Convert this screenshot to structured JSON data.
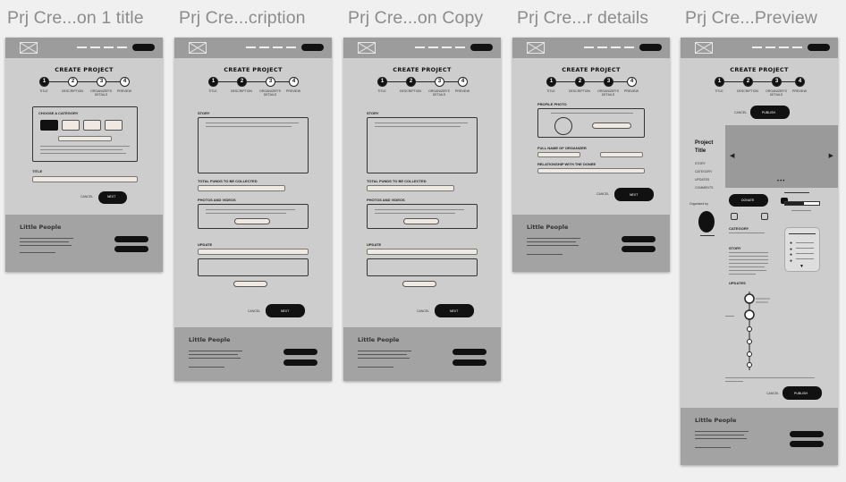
{
  "artboards": [
    {
      "title": "Prj Cre...on 1 title"
    },
    {
      "title": "Prj Cre...cription"
    },
    {
      "title": "Prj Cre...on Copy"
    },
    {
      "title": "Prj Cre...r details"
    },
    {
      "title": "Prj Cre...Preview"
    }
  ],
  "page": {
    "heading": "CREATE PROJECT",
    "steps": [
      "TITLE",
      "DESCRIPTION",
      "ORGANIZER'S DETAILS",
      "PREVIEW"
    ],
    "choose_category": "CHOOSE A CATEGORY",
    "title_label": "TITLE",
    "story_label": "STORY",
    "total_funds_label": "TOTAL FUNDS TO BE COLLECTED",
    "photos_label": "PHOTOS AND VIDEOS",
    "update_label": "UPDATE",
    "profile_photo_label": "PROFILE PHOTO",
    "full_name_label": "FULL NAME OF ORGANIZER",
    "relationship_label": "RELATIONSHIP WITH THE DONEE",
    "cancel": "CANCEL",
    "next": "NEXT",
    "publish": "PUBLISH"
  },
  "preview": {
    "project_title": "Project Title",
    "sections": [
      "STORY",
      "CATEGORY",
      "UPDATES",
      "COMMENTS"
    ],
    "category_label": "CATEGORY",
    "story_label": "STORY",
    "updates_label": "UPDATES",
    "donate": "DONATE",
    "organized_by": "Organized by"
  },
  "footer": {
    "brand": "Little People"
  }
}
